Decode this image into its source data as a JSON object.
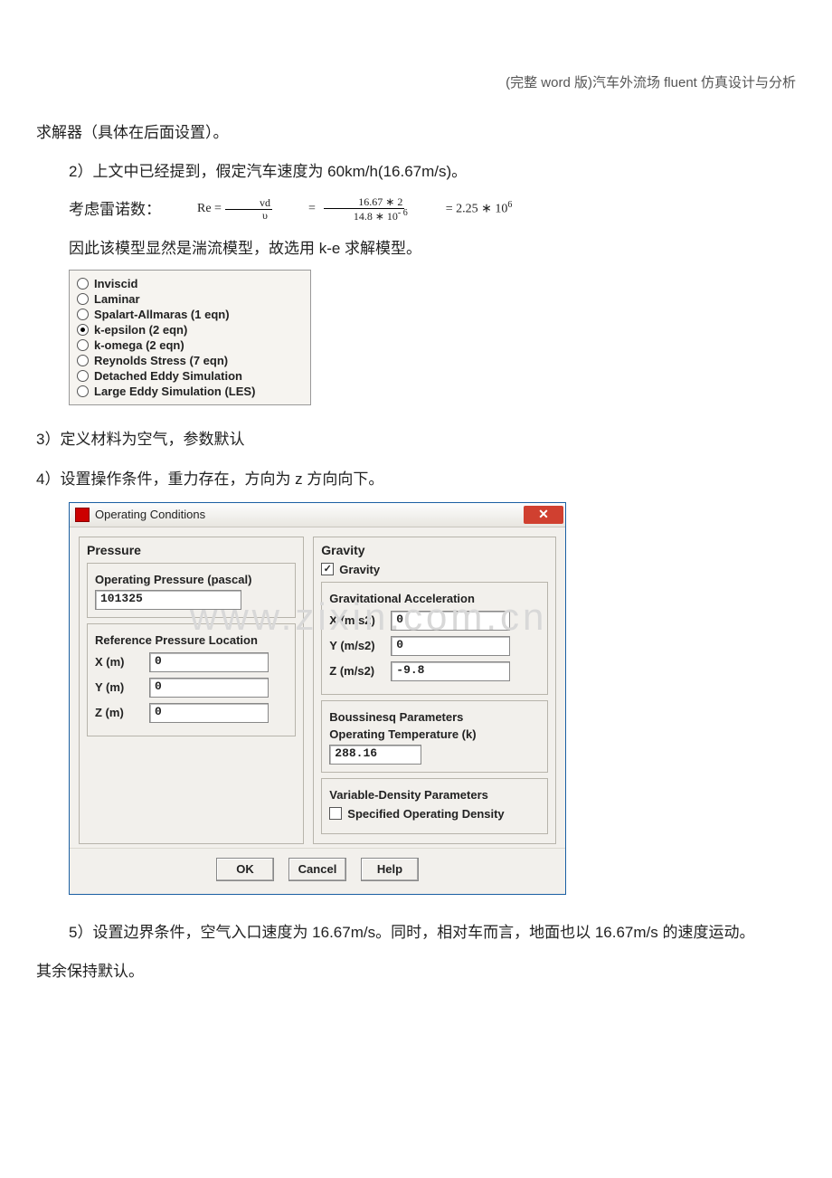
{
  "header": "(完整 word 版)汽车外流场 fluent 仿真设计与分析",
  "lines": {
    "l1": "求解器（具体在后面设置）。",
    "l2": "2）上文中已经提到，假定汽车速度为 60km/h(16.67m/s)。",
    "reynolds_label": "考虑雷诺数：",
    "re_eq_1": "Re =",
    "re_frac1_num": "vd",
    "re_frac1_den": "υ",
    "re_eq_2": "=",
    "re_frac2_num": "16.67 ∗ 2",
    "re_frac2_den": "14.8 ∗ 10",
    "re_frac2_den_exp": "- 6",
    "re_eq_3": "= 2.25 ∗ 10",
    "re_eq_3_exp": "6",
    "l3": "因此该模型显然是湍流模型，故选用 k-e 求解模型。",
    "l4": "3）定义材料为空气，参数默认",
    "l5": "4）设置操作条件，重力存在，方向为 z 方向向下。",
    "l6": "5）设置边界条件，空气入口速度为 16.67m/s。同时，相对车而言，地面也以 16.67m/s 的速度运动。",
    "l7": "其余保持默认。"
  },
  "radio": {
    "items": [
      {
        "label": "Inviscid",
        "sel": false
      },
      {
        "label": "Laminar",
        "sel": false
      },
      {
        "label": "Spalart-Allmaras   (1 eqn)",
        "sel": false
      },
      {
        "label": "k-epsilon   (2 eqn)",
        "sel": true
      },
      {
        "label": "k-omega   (2 eqn)",
        "sel": false
      },
      {
        "label": "Reynolds Stress   (7 eqn)",
        "sel": false
      },
      {
        "label": "Detached Eddy Simulation",
        "sel": false
      },
      {
        "label": "Large Eddy Simulation (LES)",
        "sel": false
      }
    ]
  },
  "dialog": {
    "title": "Operating Conditions",
    "pressure": {
      "title": "Pressure",
      "op_pressure_label": "Operating Pressure (pascal)",
      "op_pressure_value": "101325",
      "ref_loc_label": "Reference Pressure Location",
      "x_label": "X (m)",
      "x_value": "0",
      "y_label": "Y (m)",
      "y_value": "0",
      "z_label": "Z (m)",
      "z_value": "0"
    },
    "gravity": {
      "title": "Gravity",
      "gravity_chk_label": "Gravity",
      "accel_label": "Gravitational Acceleration",
      "gx_label": "X (m/s2)",
      "gx_value": "0",
      "gy_label": "Y (m/s2)",
      "gy_value": "0",
      "gz_label": "Z (m/s2)",
      "gz_value": "-9.8",
      "bouss_label": "Boussinesq Parameters",
      "op_temp_label": "Operating Temperature (k)",
      "op_temp_value": "288.16",
      "var_dens_label": "Variable-Density Parameters",
      "spec_dens_label": "Specified Operating Density"
    },
    "buttons": {
      "ok": "OK",
      "cancel": "Cancel",
      "help": "Help"
    }
  },
  "watermark": "www.zixin.com.cn"
}
